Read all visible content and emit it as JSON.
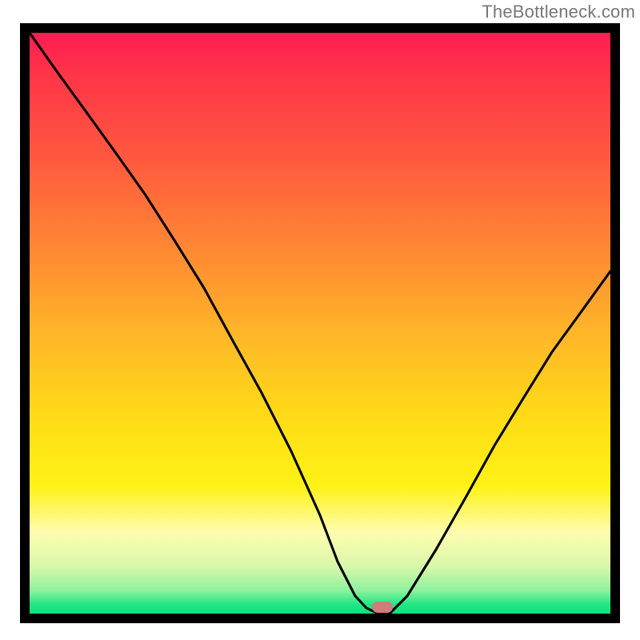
{
  "attribution": "TheBottleneck.com",
  "colors": {
    "frame": "#000000",
    "curve": "#000000",
    "marker": "#d27b7b",
    "gradient_top": "#ff1c52",
    "gradient_mid": "#ffdb17",
    "gradient_bottom": "#0ee37a"
  },
  "chart_data": {
    "type": "line",
    "title": "",
    "xlabel": "",
    "ylabel": "",
    "xlim": [
      0,
      100
    ],
    "ylim": [
      0,
      100
    ],
    "x": [
      0,
      5,
      10,
      15,
      20,
      25,
      30,
      35,
      40,
      45,
      50,
      53,
      56,
      58,
      60,
      62,
      65,
      70,
      75,
      80,
      85,
      90,
      95,
      100
    ],
    "values": [
      100,
      93,
      86,
      79,
      72,
      64,
      56,
      47,
      38,
      28,
      17,
      9,
      3,
      1,
      0,
      0,
      3,
      11,
      20,
      29,
      37,
      45,
      52,
      59
    ],
    "minimum_x": 60,
    "marker": {
      "x": 60,
      "y": 0
    }
  }
}
